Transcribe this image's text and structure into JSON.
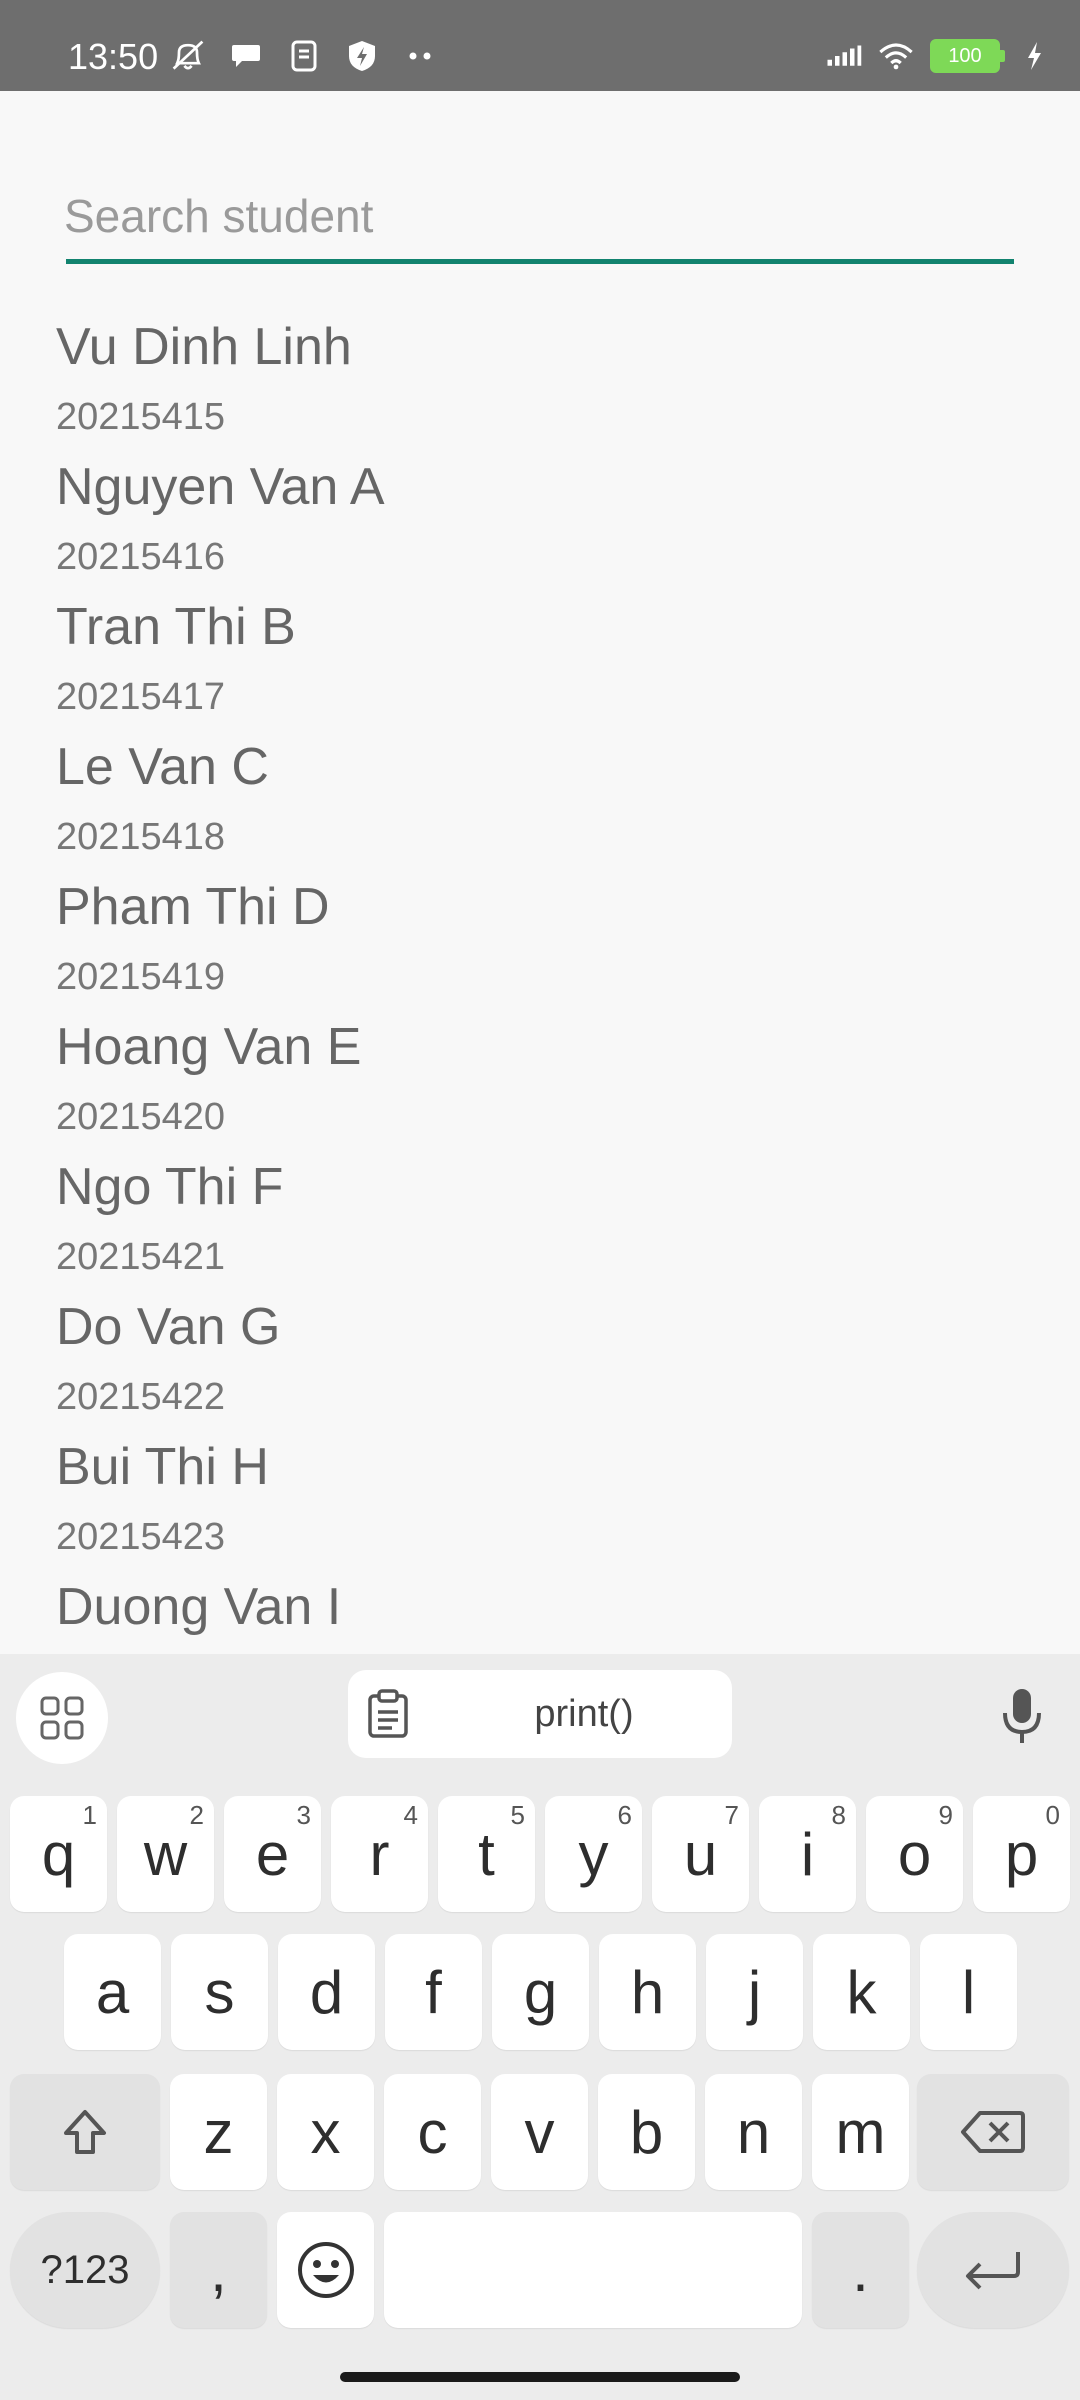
{
  "status_bar": {
    "time": "13:50",
    "battery": "100",
    "left_icons": [
      "muted-alarm-icon",
      "chat-icon",
      "sim-icon",
      "shield-icon",
      "more-dots-icon"
    ],
    "right_icons": [
      "signal-icon",
      "wifi-icon",
      "battery-icon",
      "charging-icon"
    ]
  },
  "search": {
    "placeholder": "Search student",
    "value": ""
  },
  "students": [
    {
      "name": "Vu Dinh Linh",
      "id": "20215415"
    },
    {
      "name": "Nguyen Van A",
      "id": "20215416"
    },
    {
      "name": "Tran Thi B",
      "id": "20215417"
    },
    {
      "name": "Le Van C",
      "id": "20215418"
    },
    {
      "name": "Pham Thi D",
      "id": "20215419"
    },
    {
      "name": "Hoang Van E",
      "id": "20215420"
    },
    {
      "name": "Ngo Thi F",
      "id": "20215421"
    },
    {
      "name": "Do Van G",
      "id": "20215422"
    },
    {
      "name": "Bui Thi H",
      "id": "20215423"
    },
    {
      "name": "Duong Van I",
      "id": ""
    }
  ],
  "keyboard": {
    "clipboard_text": "print()",
    "row1": [
      {
        "k": "q",
        "s": "1"
      },
      {
        "k": "w",
        "s": "2"
      },
      {
        "k": "e",
        "s": "3"
      },
      {
        "k": "r",
        "s": "4"
      },
      {
        "k": "t",
        "s": "5"
      },
      {
        "k": "y",
        "s": "6"
      },
      {
        "k": "u",
        "s": "7"
      },
      {
        "k": "i",
        "s": "8"
      },
      {
        "k": "o",
        "s": "9"
      },
      {
        "k": "p",
        "s": "0"
      }
    ],
    "row2": [
      "a",
      "s",
      "d",
      "f",
      "g",
      "h",
      "j",
      "k",
      "l"
    ],
    "row3": [
      "z",
      "x",
      "c",
      "v",
      "b",
      "n",
      "m"
    ],
    "symbols_label": "?123",
    "comma_label": ",",
    "period_label": "."
  },
  "colors": {
    "accent": "#12836f",
    "status_bar": "#6e6e6e",
    "battery": "#7ed957"
  }
}
